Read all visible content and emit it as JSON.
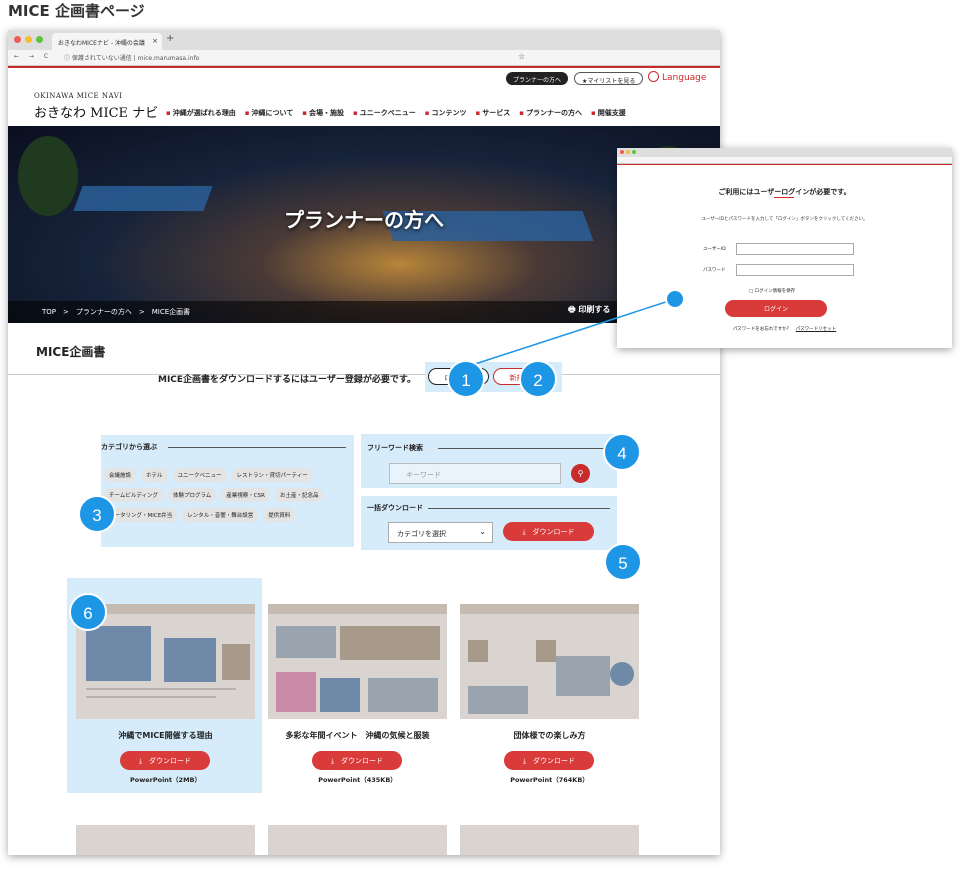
{
  "page_title": "MICE 企画書ページ",
  "browser": {
    "tab_title": "おきなわMICEナビ - 沖縄の会議",
    "tab_close": "×",
    "new_tab": "+",
    "nav_buttons": "← → C",
    "url_text": "ⓘ 保護されていない通信 | mice.marumasa.info",
    "star": "☆"
  },
  "header": {
    "planner_btn": "プランナーの方へ",
    "mylist_btn": "★マイリストを見る",
    "language": "Language",
    "logo_sub": "OKINAWA MICE NAVI",
    "logo_main": "おきなわ MICE ナビ",
    "nav": [
      "沖縄が選ばれる理由",
      "沖縄について",
      "会場・施設",
      "ユニークベニュー",
      "コンテンツ",
      "サービス",
      "プランナーの方へ",
      "開催支援"
    ]
  },
  "hero": {
    "title": "プランナーの方へ",
    "breadcrumb": "TOP　>　プランナーの方へ　>　MICE企画書",
    "print": "印刷する"
  },
  "section": {
    "title": "MICE企画書"
  },
  "register": {
    "message": "MICE企画書をダウンロードするにはユーザー登録が必要です。",
    "login": "ログイン",
    "signup": "新規登録"
  },
  "category": {
    "heading": "カテゴリから選ぶ",
    "tags": [
      "会議施設",
      "ホテル",
      "ユニークベニュー",
      "レストラン・貸切パーティー",
      "チームビルディング",
      "体験プログラム",
      "産業視察・CSR",
      "お土産・記念品",
      "ケータリング・MICE弁当",
      "レンタル・音響・舞台設営",
      "提供資料"
    ]
  },
  "keyword": {
    "heading": "フリーワード検索",
    "placeholder": "キーワード",
    "search_icon": "⚲"
  },
  "bulk": {
    "heading": "一括ダウンロード",
    "select": "カテゴリを選択",
    "button": "⤓　ダウンロード"
  },
  "cards": [
    {
      "title": "沖縄でMICE開催する理由",
      "button": "⤓　ダウンロード",
      "size": "PowerPoint（2MB）"
    },
    {
      "title": "多彩な年間イベント　沖縄の気候と服装",
      "button": "⤓　ダウンロード",
      "size": "PowerPoint（435KB）"
    },
    {
      "title": "団体様での楽しみ方",
      "button": "⤓　ダウンロード",
      "size": "PowerPoint（764KB）"
    }
  ],
  "badges": [
    "1",
    "2",
    "3",
    "4",
    "5",
    "6"
  ],
  "popup": {
    "title": "ご利用にはユーザーログインが必要です。",
    "description": "ユーザーIDとパスワードを入力して「ログイン」ボタンをクリックしてください。",
    "user_id_label": "ユーザーID",
    "password_label": "パスワード",
    "remember": "□ ログイン情報を保存",
    "login_button": "ログイン",
    "forgot": "パスワードをお忘れですか？",
    "reset": "パスワードリセット"
  },
  "colors": {
    "accent_red": "#c92b2b",
    "annotation_blue": "#1e96e6",
    "highlight": "#d6ecfa"
  }
}
